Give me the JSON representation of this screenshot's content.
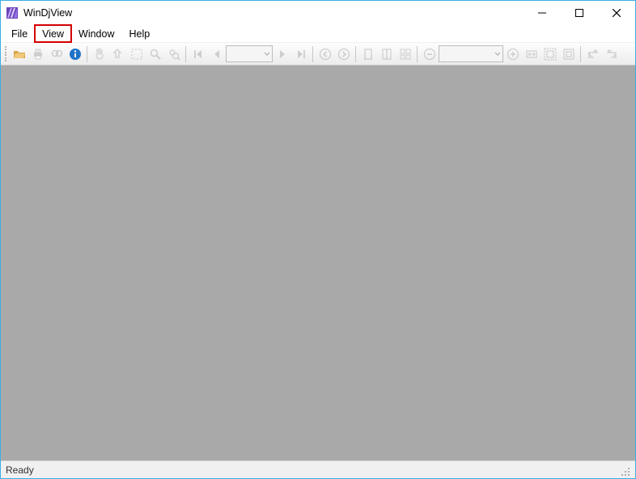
{
  "titlebar": {
    "title": "WinDjView"
  },
  "menubar": {
    "items": [
      {
        "label": "File"
      },
      {
        "label": "View",
        "highlighted": true
      },
      {
        "label": "Window"
      },
      {
        "label": "Help"
      }
    ]
  },
  "toolbar": {
    "buttons": [
      {
        "name": "open-icon",
        "enabled": true,
        "fg": "#d9a34a",
        "accent": "#2e7d32"
      },
      {
        "name": "print-icon",
        "enabled": false
      },
      {
        "name": "find-icon",
        "enabled": false
      },
      {
        "name": "info-icon",
        "enabled": true,
        "fg": "#1e73c8"
      },
      {
        "sep": true
      },
      {
        "name": "pan-icon",
        "enabled": false
      },
      {
        "name": "select-rect-icon",
        "enabled": false
      },
      {
        "name": "marquee-icon",
        "enabled": false
      },
      {
        "name": "magnify-icon",
        "enabled": false
      },
      {
        "name": "loupe-icon",
        "enabled": false
      },
      {
        "sep": true
      },
      {
        "name": "first-page-icon",
        "enabled": false
      },
      {
        "name": "prev-page-icon",
        "enabled": false
      },
      {
        "combo": true,
        "name": "page-combo",
        "value": "",
        "wide": false,
        "enabled": false
      },
      {
        "name": "next-page-icon",
        "enabled": false
      },
      {
        "name": "last-page-icon",
        "enabled": false
      },
      {
        "sep": true
      },
      {
        "name": "nav-back-icon",
        "enabled": false
      },
      {
        "name": "nav-forward-icon",
        "enabled": false
      },
      {
        "sep": true
      },
      {
        "name": "single-page-icon",
        "enabled": false
      },
      {
        "name": "continuous-icon",
        "enabled": false
      },
      {
        "name": "facing-icon",
        "enabled": false
      },
      {
        "sep": true
      },
      {
        "name": "zoom-out-icon",
        "enabled": false
      },
      {
        "combo": true,
        "name": "zoom-combo",
        "value": "",
        "wide": true,
        "enabled": false
      },
      {
        "name": "zoom-in-icon",
        "enabled": false
      },
      {
        "name": "fit-width-icon",
        "enabled": false
      },
      {
        "name": "fit-page-icon",
        "enabled": false
      },
      {
        "name": "actual-size-icon",
        "enabled": false
      },
      {
        "sep": true
      },
      {
        "name": "rotate-left-icon",
        "enabled": false
      },
      {
        "name": "rotate-right-icon",
        "enabled": false
      }
    ]
  },
  "statusbar": {
    "text": "Ready"
  },
  "colors": {
    "accent": "#3caee6",
    "highlight_border": "#d40000"
  }
}
